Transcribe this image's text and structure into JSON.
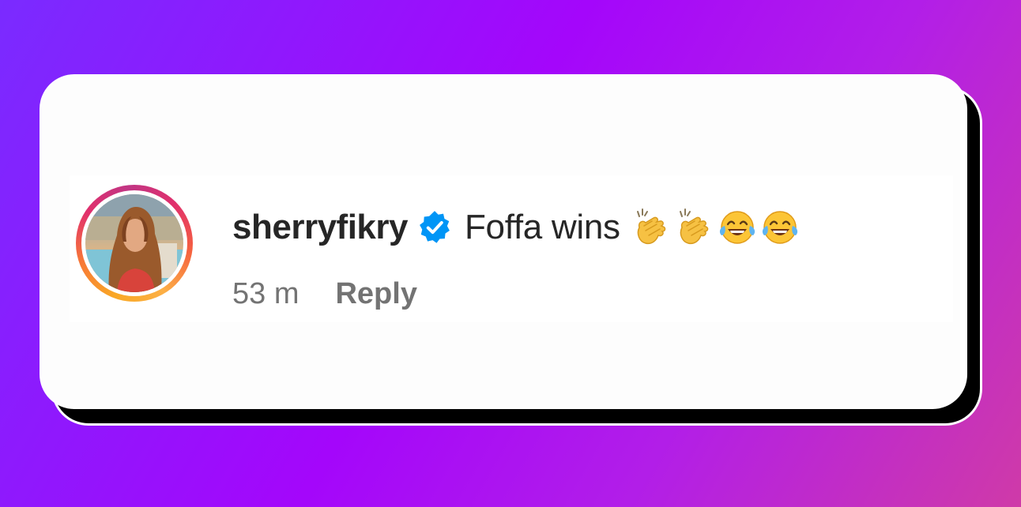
{
  "comment": {
    "username": "sherryfikry",
    "verified_icon": "verified-badge-icon",
    "text": "Foffa wins",
    "emojis": [
      "clapping-hands",
      "clapping-hands",
      "face-with-tears-of-joy",
      "face-with-tears-of-joy"
    ],
    "timestamp": "53 m",
    "reply_label": "Reply"
  },
  "colors": {
    "verified_blue": "#0095f6",
    "text_primary": "#262626",
    "text_secondary": "#737373"
  }
}
